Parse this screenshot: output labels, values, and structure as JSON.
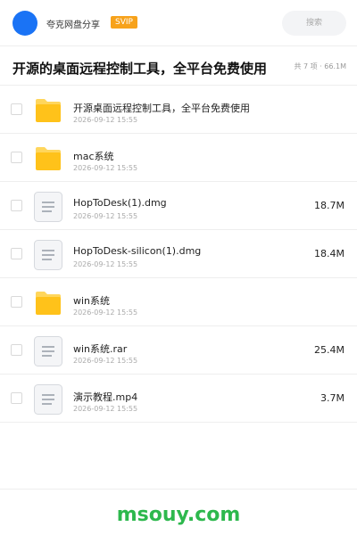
{
  "header": {
    "app_name": "夸克网盘分享",
    "badge": "SVIP",
    "search_placeholder": "搜索"
  },
  "share": {
    "title": "开源的桌面远程控制工具，全平台免费使用",
    "summary": "共 7 项 · 66.1M"
  },
  "files": [
    {
      "name": "开源桌面远程控制工具，全平台免费使用",
      "date": "2026-09-12 15:55",
      "size": "",
      "icon": "folder-icon"
    },
    {
      "name": "mac系统",
      "date": "2026-09-12 15:55",
      "size": "",
      "icon": "folder-icon"
    },
    {
      "name": "HopToDesk(1).dmg",
      "date": "2026-09-12 15:55",
      "size": "18.7M",
      "icon": "document-icon"
    },
    {
      "name": "HopToDesk-silicon(1).dmg",
      "date": "2026-09-12 15:55",
      "size": "18.4M",
      "icon": "document-icon"
    },
    {
      "name": "win系统",
      "date": "2026-09-12 15:55",
      "size": "",
      "icon": "folder-icon"
    },
    {
      "name": "win系统.rar",
      "date": "2026-09-12 15:55",
      "size": "25.4M",
      "icon": "document-icon"
    },
    {
      "name": "演示教程.mp4",
      "date": "2026-09-12 15:55",
      "size": "3.7M",
      "icon": "document-icon"
    }
  ],
  "footer": {
    "watermark": "msouy.com"
  },
  "colors": {
    "accent": "#1a73f5",
    "svip": "#f7a21b",
    "folder": "#ffc21a",
    "watermark": "#2db84d"
  }
}
